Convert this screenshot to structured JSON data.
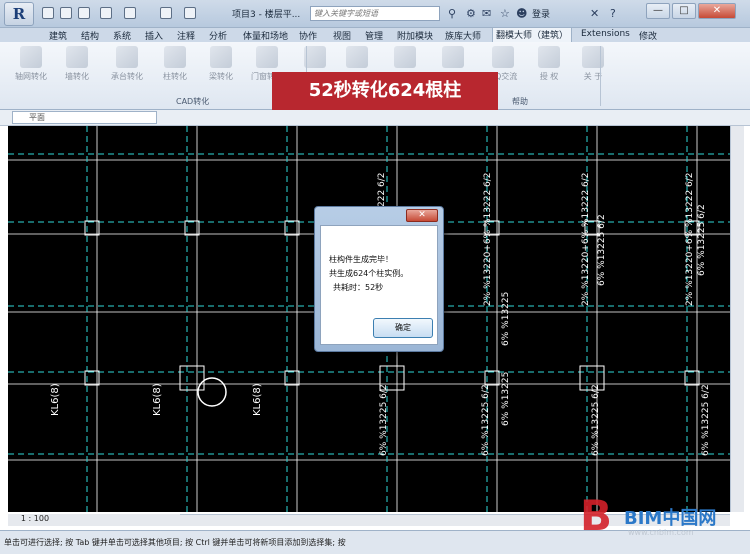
{
  "titlebar": {
    "app_button": "R",
    "title": "项目3 - 楼层平...",
    "search_placeholder": "键入关键字或短语",
    "login": "登录",
    "close_glyph": "✕",
    "min_glyph": "—",
    "max_glyph": "□"
  },
  "tabs": [
    "建筑",
    "结构",
    "系统",
    "插入",
    "注释",
    "分析",
    "体量和场地",
    "协作",
    "视图",
    "管理",
    "附加模块",
    "族库大师",
    "翻模大师（建筑）",
    "Extensions",
    "修改"
  ],
  "active_tab_index": 12,
  "ribbon": {
    "buttons": [
      "轴网转化",
      "墙转化",
      "承台转化",
      "柱转化",
      "梁转化",
      "门窗转化",
      "",
      "",
      "",
      "",
      "QQ交流",
      "授 权",
      "关 于"
    ],
    "panel_cad": "CAD转化",
    "panel_help": "帮助"
  },
  "banner": "52秒转化624根柱",
  "properties": {
    "select_value": "平面",
    "icon_text": "楼"
  },
  "canvas": {
    "labels_vertical": [
      "KL6(8)",
      "KL6(8)",
      "KL6(8)"
    ],
    "column_text_1": "2% %13220+6% %13222 6/2",
    "column_text_2": "6% %13225 6/2",
    "column_text_3": "6% %13225"
  },
  "dialog": {
    "close_glyph": "✕",
    "line1": "柱构件生成完毕！",
    "line2": "共生成624个柱实例。",
    "line3": "共耗时：52秒",
    "ok": "确定"
  },
  "scale": "1 : 100",
  "status": "单击可进行选择; 按 Tab 键并单击可选择其他项目; 按 Ctrl 键并单击可将新项目添加到选择集; 按",
  "watermark": {
    "logo": "B",
    "name": "BIM中国网",
    "url": "www.cnbim.com"
  },
  "colors": {
    "banner": "#b8272f",
    "canvas_bg": "#000000",
    "grid_line": "#2fd7d7",
    "beam_line": "#ffffff"
  }
}
